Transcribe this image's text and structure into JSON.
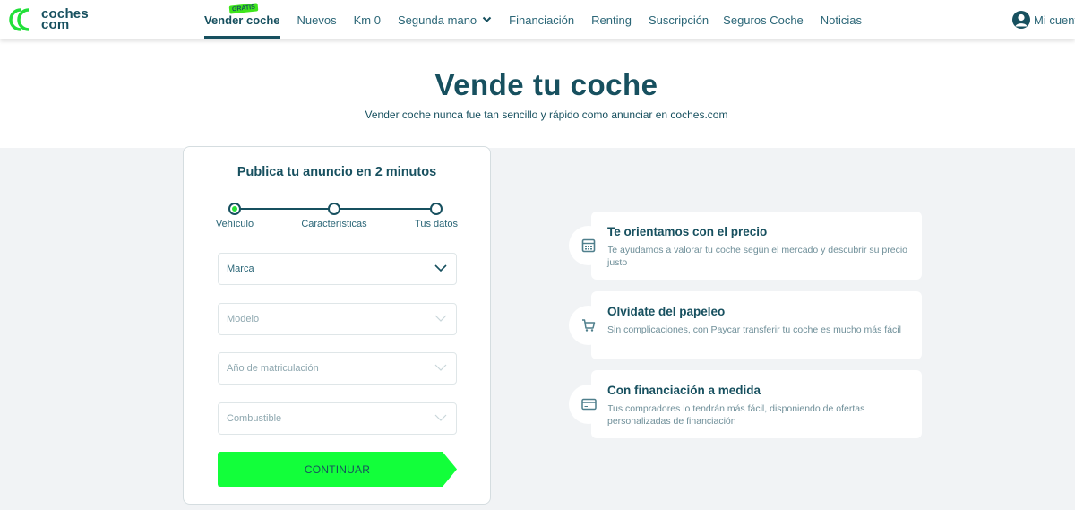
{
  "brand": {
    "name_line1": "coches",
    "name_line2": "com",
    "accent": "#3fe61c",
    "primary": "#17505f"
  },
  "nav": {
    "items": [
      {
        "label": "Vender coche",
        "badge": "GRATIS",
        "active": true
      },
      {
        "label": "Nuevos"
      },
      {
        "label": "Km 0"
      },
      {
        "label": "Segunda mano",
        "has_dropdown": true
      },
      {
        "label": "Financiación"
      },
      {
        "label": "Renting"
      },
      {
        "label": "Suscripción"
      },
      {
        "label": "Seguros Coche"
      },
      {
        "label": "Noticias"
      }
    ],
    "account_label": "Mi cuenta"
  },
  "hero": {
    "title": "Vende tu coche",
    "subtitle": "Vender coche nunca fue tan sencillo y rápido como anunciar en coches.com"
  },
  "form": {
    "title": "Publica tu anuncio en 2 minutos",
    "steps": [
      {
        "label": "Vehículo",
        "active": true
      },
      {
        "label": "Características",
        "active": false
      },
      {
        "label": "Tus datos",
        "active": false
      }
    ],
    "selects": [
      {
        "placeholder": "Marca",
        "enabled": true
      },
      {
        "placeholder": "Modelo",
        "enabled": false
      },
      {
        "placeholder": "Año de matriculación",
        "enabled": false
      },
      {
        "placeholder": "Combustible",
        "enabled": false
      }
    ],
    "continue_label": "CONTINUAR"
  },
  "features": [
    {
      "icon": "calculator-icon",
      "title": "Te orientamos con el precio",
      "text": "Te ayudamos a valorar tu coche según el mercado y descubrir su precio justo"
    },
    {
      "icon": "cart-icon",
      "title": "Olvídate del papeleo",
      "text": "Sin complicaciones, con Paycar transferir tu coche es mucho más fácil"
    },
    {
      "icon": "credit-card-icon",
      "title": "Con financiación a medida",
      "text": "Tus compradores lo tendrán más fácil, disponiendo de ofertas personalizadas de financiación"
    }
  ]
}
